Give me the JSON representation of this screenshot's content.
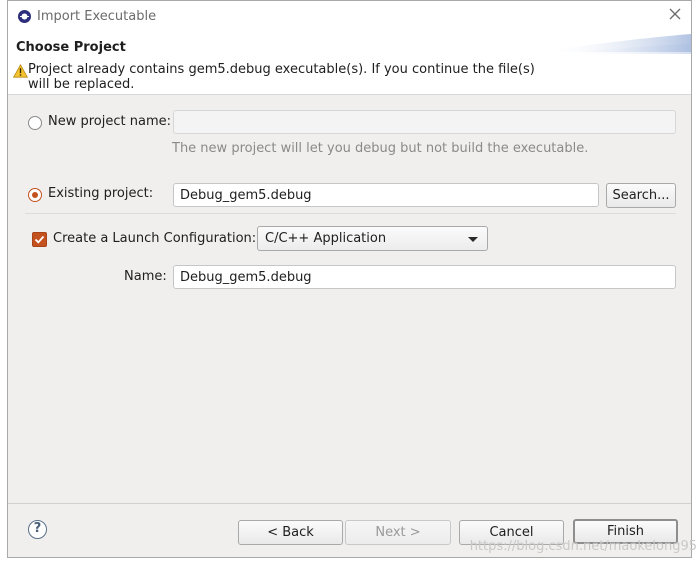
{
  "window": {
    "title": "Import Executable"
  },
  "header": {
    "title": "Choose Project",
    "warning_line1": "Project already contains gem5.debug executable(s). If you continue the file(s)",
    "warning_line2": "will be replaced."
  },
  "form": {
    "new_project_label": "New project name:",
    "new_project_value": "",
    "new_project_hint": "The new project will let you debug but not build the executable.",
    "existing_project_label": "Existing project:",
    "existing_project_value": "Debug_gem5.debug",
    "search_button": "Search...",
    "launch_config_label": "Create a Launch Configuration:",
    "launch_config_checked": true,
    "launch_type_selected": "C/C++ Application",
    "name_label": "Name:",
    "name_value": "Debug_gem5.debug"
  },
  "footer": {
    "back_button": "< Back",
    "next_button": "Next >",
    "cancel_button": "Cancel",
    "finish_button": "Finish"
  },
  "watermark": "https://blog.csdn.net/maokelong95",
  "colors": {
    "accent": "#c4521e",
    "dialog_bg": "#f0efee"
  }
}
